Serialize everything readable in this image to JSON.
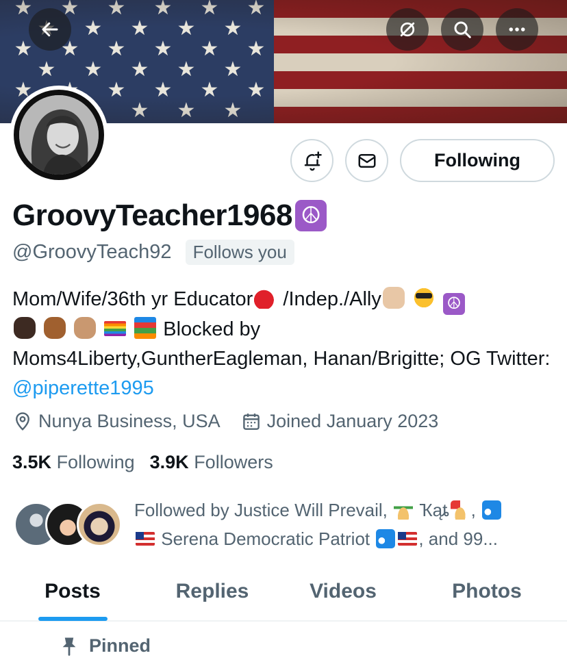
{
  "profile": {
    "display_name": "GroovyTeacher1968",
    "badge_glyph": "☮",
    "handle": "@GroovyTeach92",
    "follows_you": "Follows you",
    "bio": {
      "t1": "Mom/Wife/36th yr Educator",
      "t2": " /Indep./Ally",
      "t3": " Blocked by Moms4Liberty,GuntherEagleman, Hanan/Brigitte; OG Twitter: ",
      "link": "@piperette1995",
      "peace": "☮"
    },
    "location": "Nunya Business, USA",
    "joined": "Joined January 2023",
    "following_count": "3.5K",
    "following_label": "Following",
    "followers_count": "3.9K",
    "followers_label": "Followers",
    "followed_by": {
      "p1": "Followed by Justice Will Prevail, ",
      "p2": " Ҡąȶ",
      "p3": ", ",
      "p4": " Serena Democratic Patriot ",
      "p5": ", and 99..."
    }
  },
  "actions": {
    "following_button": "Following"
  },
  "tabs": [
    {
      "label": "Posts",
      "active": true
    },
    {
      "label": "Replies",
      "active": false
    },
    {
      "label": "Videos",
      "active": false
    },
    {
      "label": "Photos",
      "active": false
    }
  ],
  "pinned_label": "Pinned",
  "icons": {
    "back": "back-arrow-icon",
    "grok": "grok-icon",
    "search": "search-icon",
    "more": "more-icon",
    "notify": "bell-plus-icon",
    "message": "envelope-icon",
    "location": "location-pin-icon",
    "calendar": "calendar-icon",
    "pin": "pin-icon"
  },
  "colors": {
    "accent": "#1d9bf0",
    "secondary_text": "#536471",
    "primary_text": "#0f1419",
    "border": "#cfd9de"
  }
}
